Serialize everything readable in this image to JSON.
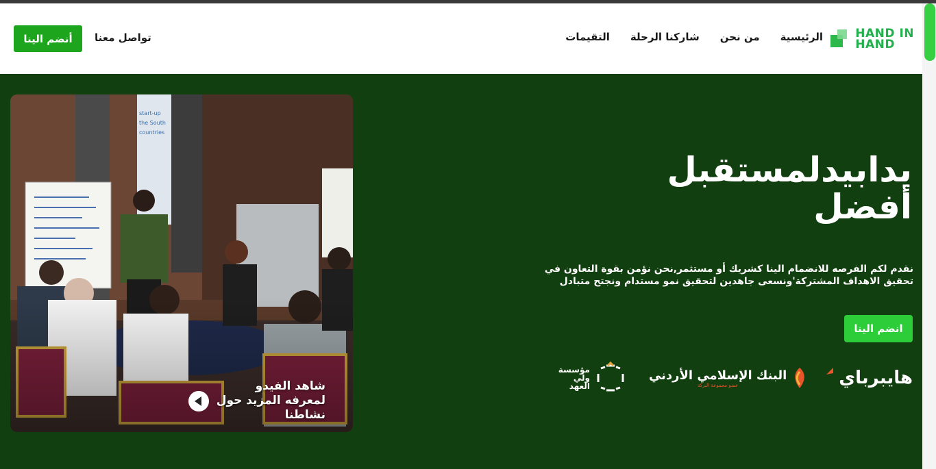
{
  "brand": {
    "logo_line1": "HAND IN",
    "logo_line2": "HAND",
    "accent_color": "#22b14c",
    "hero_bg": "#123f0f"
  },
  "nav": {
    "items": [
      {
        "label": "الرئيسية"
      },
      {
        "label": "من نحن"
      },
      {
        "label": "شاركنا الرحلة"
      },
      {
        "label": "التقيمات"
      }
    ],
    "contact_label": "تواصل معنا",
    "join_label": "أنضم الينا"
  },
  "hero": {
    "headline_line1": "يدابيدلمستقبل",
    "headline_line2": "أفضل",
    "description": "نقدم لكم الفرصه للانضمام الينا كشريك أو مستثمر,نحن نؤمن بقوة التعاون في تحقيق الاهداف المشتركة'ونسعى جاهدين لتحقيق نمو مستدام ونجتح متبادل",
    "join_label": "انضم الينا",
    "video_cta": "شاهد الفيدو لمعرفه المزيد حول نشاطنا",
    "photo_board_text": "start-up the South countries"
  },
  "partners": {
    "waliahd_line1": "مؤسسة",
    "waliahd_line2": "ولي",
    "waliahd_line3": "العهد",
    "bank_name": "البنك الإسلامي الأردني",
    "bank_sub": "عضو مجموعة البركة",
    "hyperpay": "هايبرباي"
  }
}
